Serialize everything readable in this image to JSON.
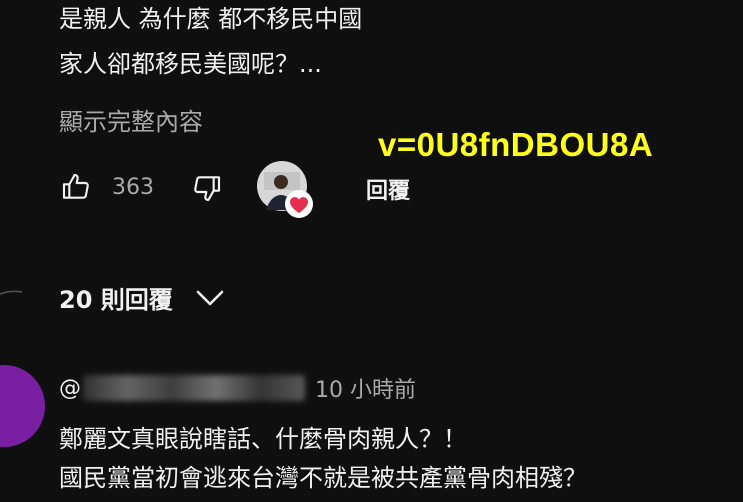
{
  "comment": {
    "lines": [
      "是親人 為什麼 都不移民中國",
      "家人卻都移民美國呢？..."
    ],
    "show_more": "顯示完整內容",
    "like_count": "363",
    "reply_label": "回覆"
  },
  "overlay": {
    "watermark": "v=0U8fnDBOU8A",
    "color": "#ffff1a"
  },
  "replies": {
    "toggle_label": "20 則回覆",
    "first": {
      "handle_prefix": "@",
      "time": "10 小時前",
      "lines": [
        "鄭麗文真眼說瞎話、什麼骨肉親人？！",
        "國民黨當初會逃來台灣不就是被共產黨骨肉相殘？"
      ],
      "avatar_color": "#7b1fa2"
    }
  },
  "icons": [
    "thumbs-up-icon",
    "thumbs-down-icon",
    "creator-heart-icon",
    "chevron-down-icon"
  ]
}
